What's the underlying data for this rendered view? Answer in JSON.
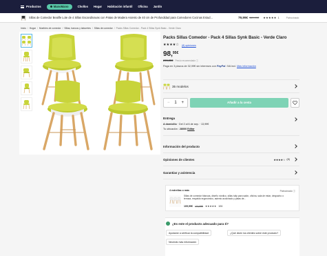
{
  "topnav": {
    "menu_label": "Productos",
    "pill_label": "ManoMano",
    "items": [
      "Chollos",
      "Hogar",
      "Habitación infantil",
      "Oficina",
      "Jardín"
    ]
  },
  "product_bar": {
    "title": "Sillas de Comedor Bealife Lote de 4 Sillas Escandinavas con Patas de Madera Asiento de 40 cm de Profundidad para Comedores Cocinas Estud...",
    "price": "79,99€",
    "old_price": "119,99€",
    "stars": "★★★★★",
    "count": "1",
    "sponsored": "Patrocinado"
  },
  "breadcrumb": [
    "Inicio",
    "Hogar",
    "Muebles de comedor",
    "Sillas, bancos y taburetes",
    "Sillas de comedor",
    "Packs Sillas Comedor - Pack 4 Sillas Synk Basic - Verde Claro"
  ],
  "product": {
    "title": "Packs Sillas Comedor - Pack 4 Sillas Synk Basic - Verde Claro",
    "stars": "★★★★☆",
    "opinions": "(8) opiniones",
    "price_int": "98,",
    "price_dec": "95€",
    "old_price": "299,95€",
    "recommended_label": "Precio recomendado ⓘ",
    "payment_text_1": "Paga en 3 plazos de 32,99€ sin intereses con",
    "payment_brand": "PayPal",
    "payment_text_2": ". IVA incl.",
    "more_info": "Más información",
    "models_label": "35 modelos",
    "qty": "1",
    "add_to_cart": "Añadir a la cesta"
  },
  "delivery": {
    "title": "Entrega",
    "home_label": "A domicilio",
    "home_dates": " · Del 2 al 6 de sep. · 13,99€",
    "location_label": "Tu ubicación :",
    "postcode": "28000",
    "edit": "Editar"
  },
  "accordions": [
    {
      "label": "Información del producto",
      "rating": "",
      "count": ""
    },
    {
      "label": "Opiniones de clientes",
      "rating": "★★★★☆",
      "count": "(8)"
    },
    {
      "label": "Garantías y asistencia",
      "rating": "",
      "count": ""
    }
  ],
  "recommendation": {
    "title": "4 estrellas o más",
    "sponsored": "Patrocinado ⓘ",
    "desc": "Sillas de comedor blancas, diseño nórdico, sillas tulip para salón, oficina, sala de estar, despacho o terraza, respaldo ergonómico, asiento acolchado y patas de...",
    "price": "109,99€",
    "old_price": "119,99€",
    "stars": "★★★★★",
    "count": "106"
  },
  "ask": {
    "question": "¿Es este el producto adecuado para ti?",
    "chips": [
      "Ayúdame a verificar la compatibilidad",
      "¿Qué dicen los clientes sobre este producto?",
      "Necesito más información"
    ]
  },
  "colors": {
    "nav_bg": "#1b1e3c",
    "accent": "#59c7a8",
    "cta": "#7ed3b5",
    "chair_seat": "#c8d43a",
    "chair_wood": "#d9a766"
  }
}
